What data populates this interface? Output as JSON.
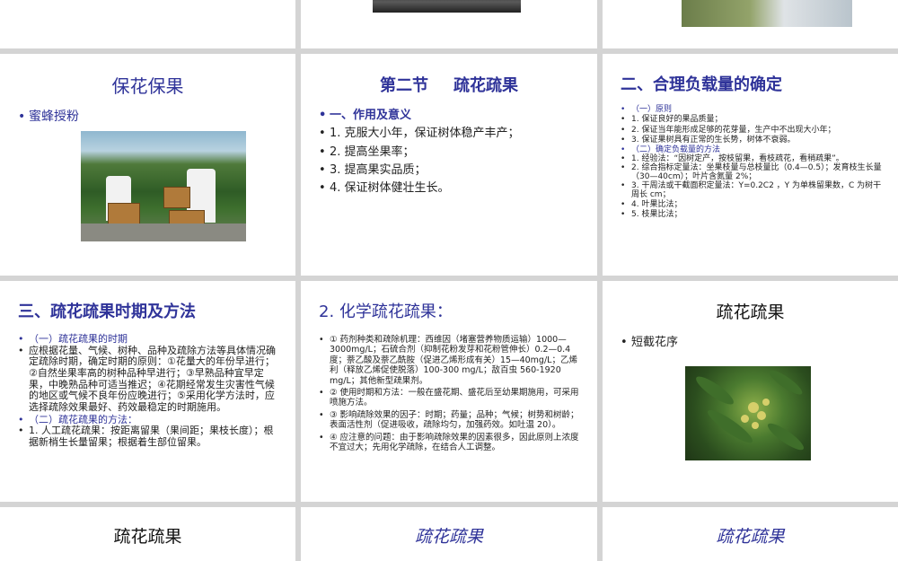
{
  "slides": {
    "s_bee": {
      "title": "保花保果",
      "items": [
        "蜜蜂授粉"
      ]
    },
    "s_section2": {
      "title_a": "第二节",
      "title_b": "疏花疏果",
      "items": [
        "一、作用及意义",
        "1. 克服大小年，保证树体稳产丰产；",
        "2. 提高坐果率；",
        "3. 提高果实品质；",
        "4. 保证树体健壮生长。"
      ]
    },
    "s_load": {
      "title": "二、合理负载量的确定",
      "items": [
        "（一）原则",
        "1. 保证良好的果品质量；",
        "2. 保证当年能形成足够的花芽量，生产中不出现大小年；",
        "3. 保证果树具有正常的生长势，树体不衰弱。",
        "（二）确定负载量的方法",
        "1. 经验法：“因树定产，按枝留果，看枝疏花，看稍疏果”。",
        "2. 综合指标定量法：坐果枝量与总枝量比（0.4—0.5）；发育枝生长量（30—40cm）；叶片含氮量 2%；",
        "3. 干周法或干截面积定量法：Y=0.2C2 ，Y 为单株留果数，C 为树干周长 cm；",
        "4. 叶果比法；",
        "5. 枝果比法；"
      ]
    },
    "s_period": {
      "title": "三、疏花疏果时期及方法",
      "items": [
        "（一）疏花疏果的时期",
        "应根据花量、气候、树种、品种及疏除方法等具体情况确定疏除时期，确定时期的原则：①花量大的年份早进行；②自然坐果率高的树种品种早进行；③早熟品种宜早定果，中晚熟品种可适当推迟；④花期经常发生灾害性气候的地区或气候不良年份应晚进行；⑤采用化学方法时，应选择疏除效果最好、药效最稳定的时期施用。",
        "（二）疏花疏果的方法：",
        "1. 人工疏花疏果：按距离留果（果间距；果枝长度）；根据新梢生长量留果；根据着生部位留果。"
      ]
    },
    "s_chem": {
      "title": "2. 化学疏花疏果：",
      "items": [
        "① 药剂种类和疏除机理：西维因（堵塞营养物质运输）1000—3000mg/L；石硫合剂（抑制花粉发芽和花粉管伸长）0.2—0.4 度；萘乙酸及萘乙酰胺（促进乙烯形成有关）15—40mg/L；乙烯利（释放乙烯促使脱落）100-300 mg/L；敌百虫 560-1920 mg/L；其他新型疏果剂。",
        "② 使用时期和方法：一般在盛花期、盛花后至幼果期施用，可采用喷施方法。",
        "③ 影响疏除效果的因子：时期；药量；品种；气候；树势和树龄；表面活性剂（促进吸收，疏除均匀，加强药效。如吐温 20）。",
        "④ 应注意的问题：由于影响疏除效果的因素很多，因此原则上浓度不宜过大；先用化学疏除，在结合人工调整。"
      ]
    },
    "s_flower": {
      "title": "疏花疏果",
      "items": [
        "短截花序"
      ]
    },
    "s_bottom1": {
      "title": "疏花疏果"
    },
    "s_bottom2": {
      "title": "疏花疏果"
    },
    "s_bottom3": {
      "title": "疏花疏果"
    }
  }
}
